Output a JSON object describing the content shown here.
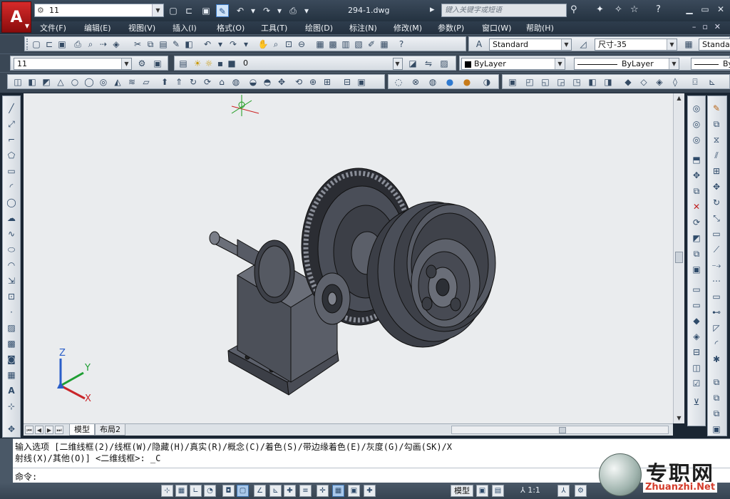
{
  "titlebar": {
    "app_logo": "A",
    "workspace": "11",
    "document_title": "294-1.dwg",
    "search_placeholder": "键入关键字或短语"
  },
  "menu": [
    "文件(F)",
    "编辑(E)",
    "视图(V)",
    "插入(I)",
    "格式(O)",
    "工具(T)",
    "绘图(D)",
    "标注(N)",
    "修改(M)",
    "参数(P)",
    "窗口(W)",
    "帮助(H)"
  ],
  "styles_toolbar": {
    "text_style": "Standard",
    "dim_style": "尺寸-35",
    "table_style": "Standard"
  },
  "layers_toolbar": {
    "layer_state": "11",
    "current_layer": "0",
    "color": "ByLayer",
    "linetype": "ByLayer",
    "lineweight": "ByLayer"
  },
  "tabs": {
    "model": "模型",
    "layout2": "布局2"
  },
  "command_line": {
    "history_line_1": "输入选项 [二维线框(2)/线框(W)/隐藏(H)/真实(R)/概念(C)/着色(S)/带边缘着色(E)/灰度(G)/勾画(SK)/X",
    "history_line_2": "射线(X)/其他(O)] <二维线框>: _C",
    "prompt": "命令:"
  },
  "statusbar": {
    "model_label": "模型",
    "annotation_scale": "1:1"
  },
  "watermark": {
    "chinese": "专职网",
    "english": "Zhuanzhi.Net"
  },
  "ucs_axes": {
    "x": "X",
    "y": "Y",
    "z": "Z"
  },
  "colors": {
    "model_shade": "#4a4e58",
    "canvas_bg": "#eaecee",
    "frame": "#2e3b49"
  }
}
